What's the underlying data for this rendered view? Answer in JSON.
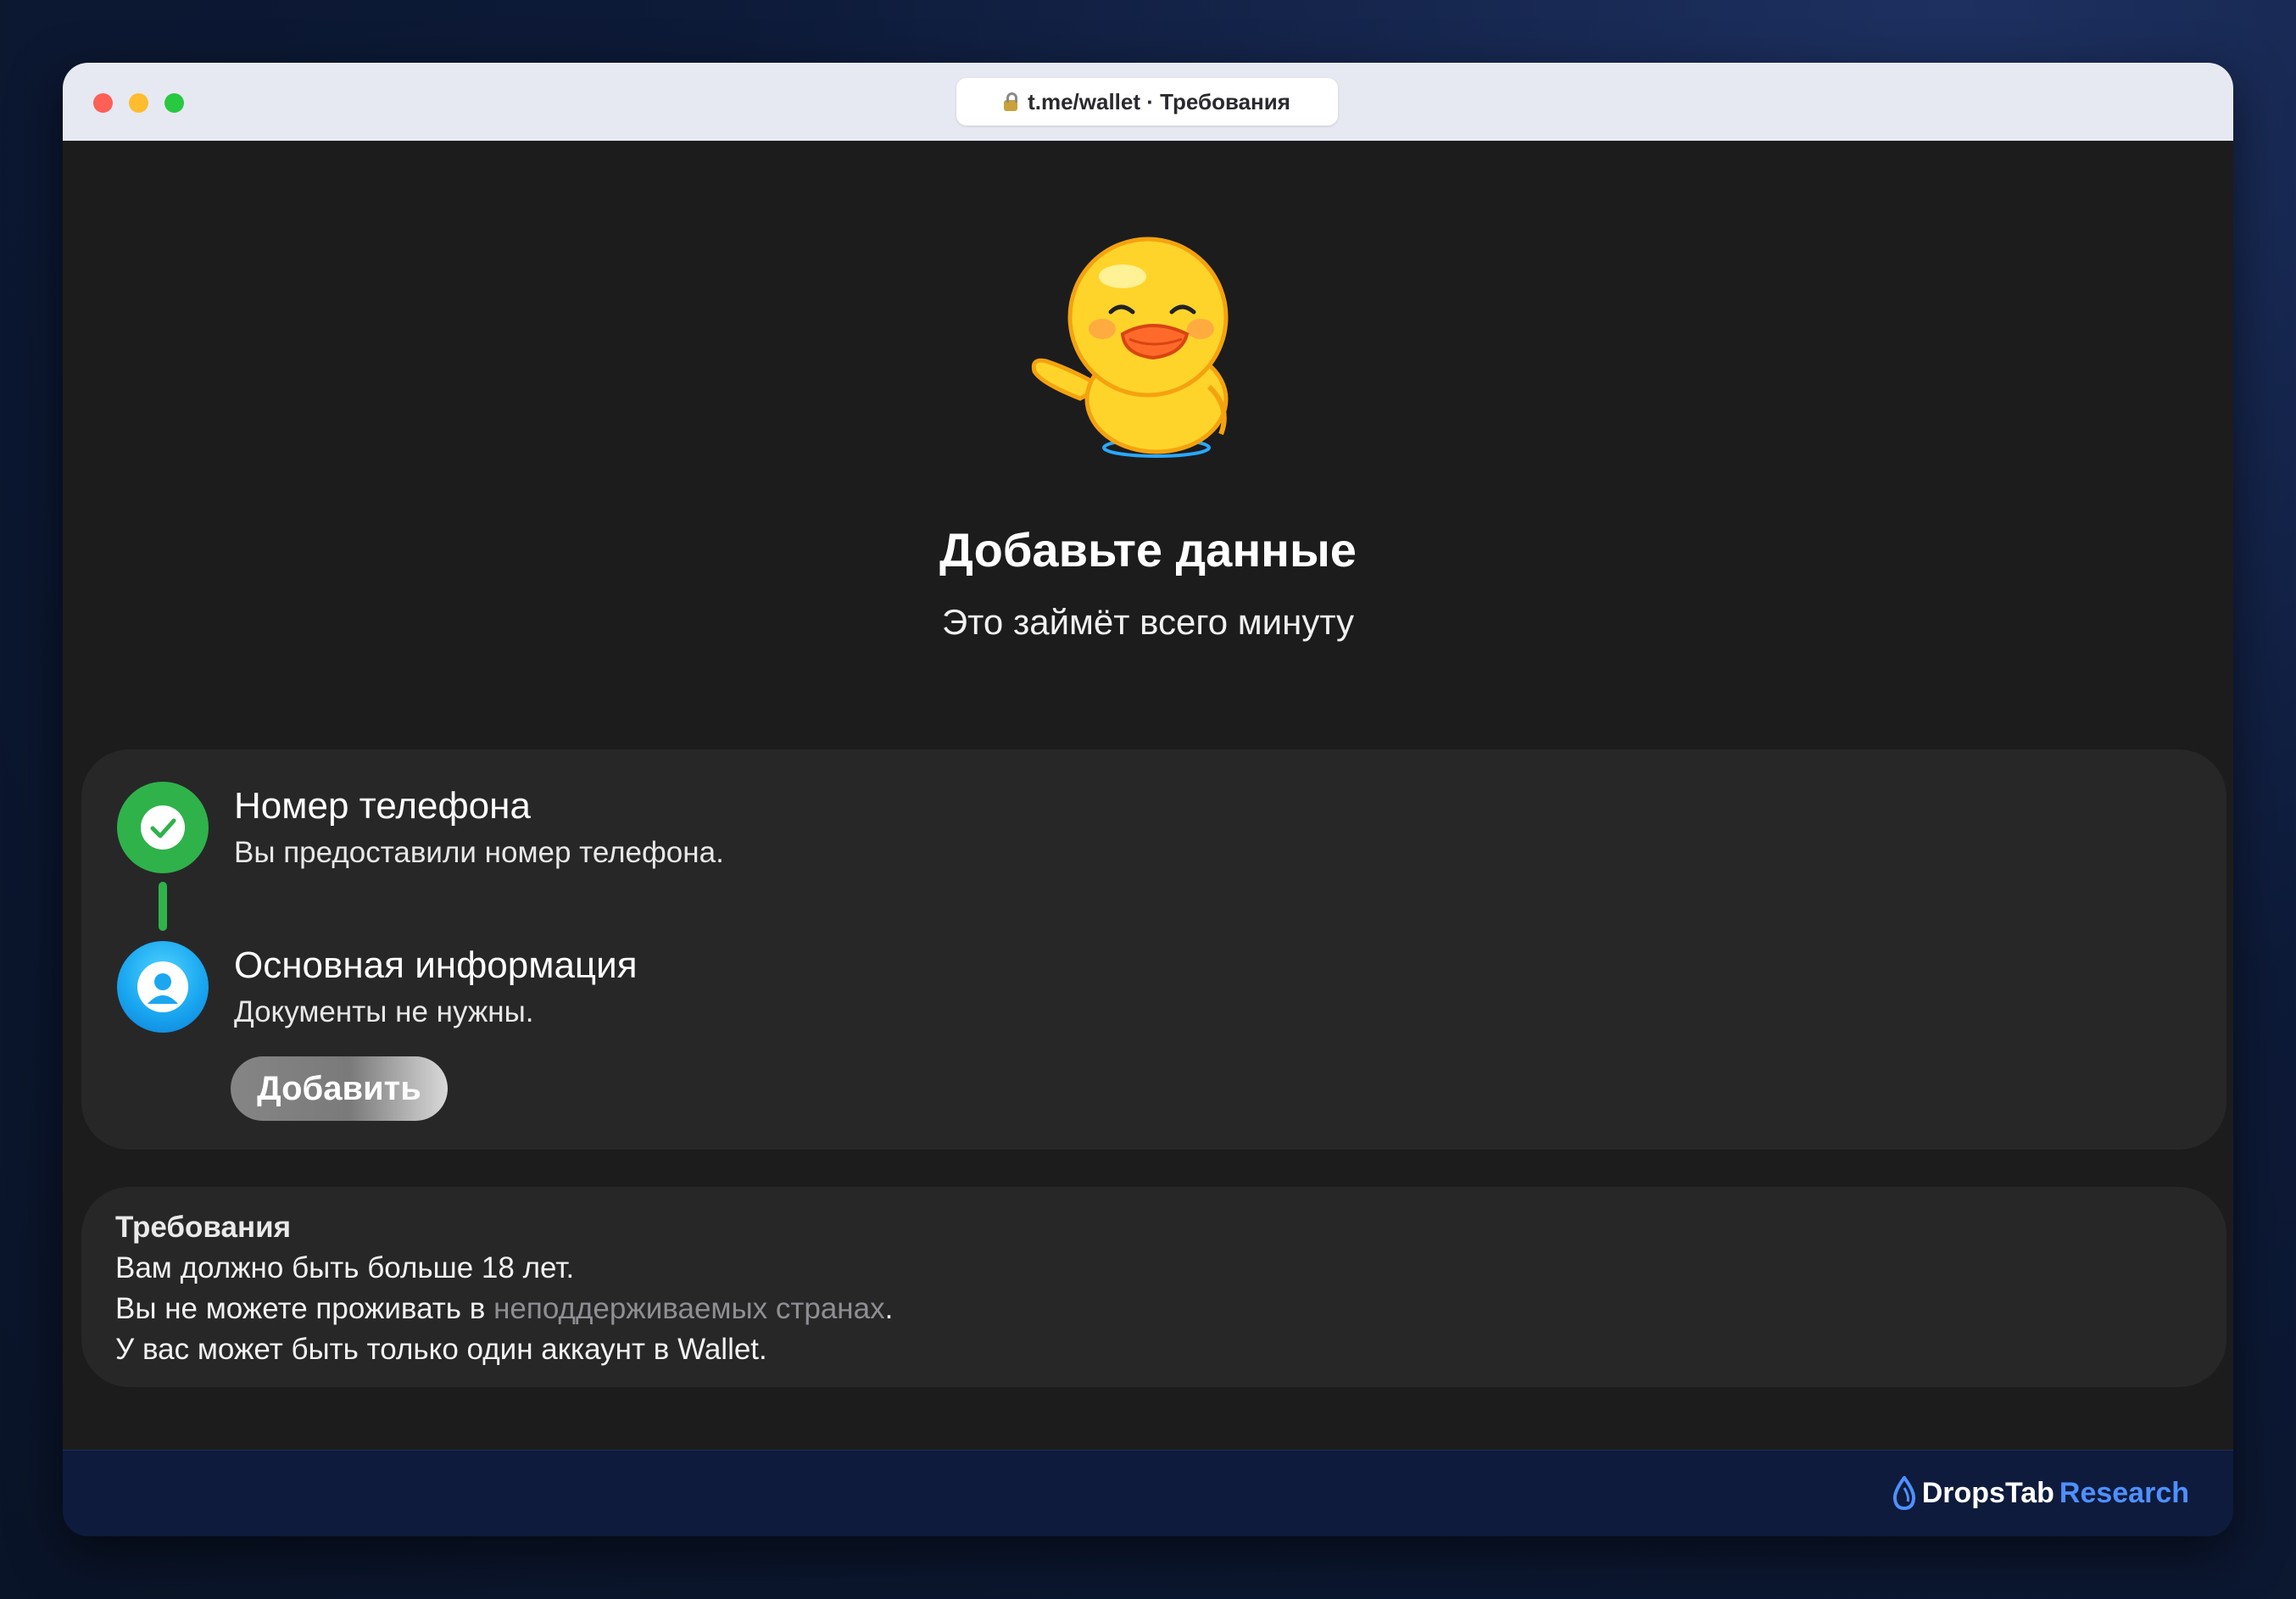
{
  "browser": {
    "url": "t.me/wallet · Требования"
  },
  "hero": {
    "title": "Добавьте данные",
    "subtitle": "Это займёт всего минуту"
  },
  "steps": [
    {
      "title": "Номер телефона",
      "description": "Вы предоставили номер телефона.",
      "status": "done"
    },
    {
      "title": "Основная информация",
      "description": "Документы не нужны.",
      "action_label": "Добавить"
    }
  ],
  "requirements": {
    "title": "Требования",
    "line1": "Вам должно быть больше 18 лет.",
    "line2_prefix": "Вы не можете проживать в ",
    "line2_link": "неподдерживаемых странах",
    "line2_suffix": ".",
    "line3": "У вас может быть только один аккаунт в Wallet."
  },
  "footer": {
    "brand_primary": "DropsTab",
    "brand_secondary": "Research"
  },
  "colors": {
    "success": "#2fb24a",
    "accent_blue": "#1aa7f0",
    "background": "#1c1c1d",
    "card": "#272728"
  }
}
